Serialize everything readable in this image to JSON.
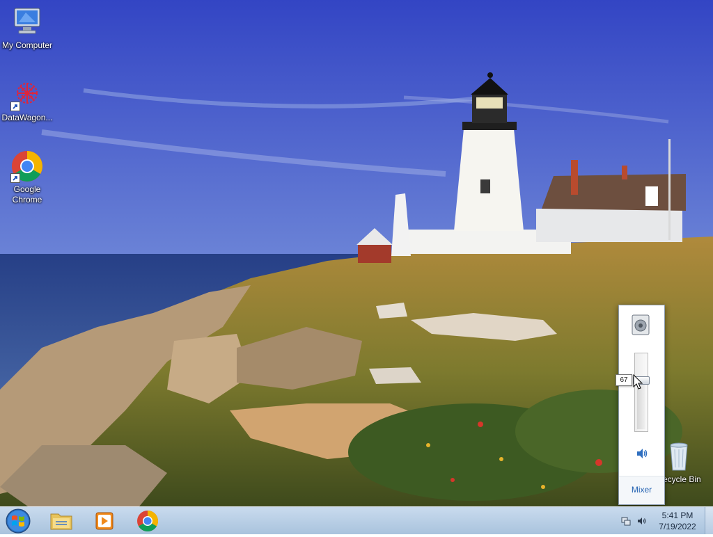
{
  "desktop": {
    "icons": [
      {
        "label": "My Computer",
        "icon": "computer-icon"
      },
      {
        "label": "DataWagon...",
        "icon": "datawagon-icon"
      },
      {
        "label": "Google\nChrome",
        "icon": "chrome-icon"
      },
      {
        "label": "Recycle Bin",
        "icon": "recycle-bin-icon"
      }
    ]
  },
  "volume_popup": {
    "value_label": "67",
    "level": 0.67,
    "mixer_label": "Mixer",
    "device_icon": "speaker-device-icon",
    "mute_icon": "speaker-icon"
  },
  "taskbar": {
    "buttons": [
      {
        "name": "start-button",
        "icon": "windows-logo-icon"
      },
      {
        "name": "file-explorer-button",
        "icon": "folder-icon"
      },
      {
        "name": "media-player-button",
        "icon": "media-player-icon"
      },
      {
        "name": "chrome-button",
        "icon": "chrome-icon"
      }
    ],
    "tray": [
      {
        "name": "network-icon"
      },
      {
        "name": "volume-icon"
      }
    ],
    "clock": {
      "time": "5:41 PM",
      "date": "7/19/2022"
    }
  },
  "colors": {
    "taskbar": "#b3cbe3",
    "popup_link": "#1f5fb0",
    "sky_top": "#3a55c8",
    "sea": "#2c4e92"
  }
}
